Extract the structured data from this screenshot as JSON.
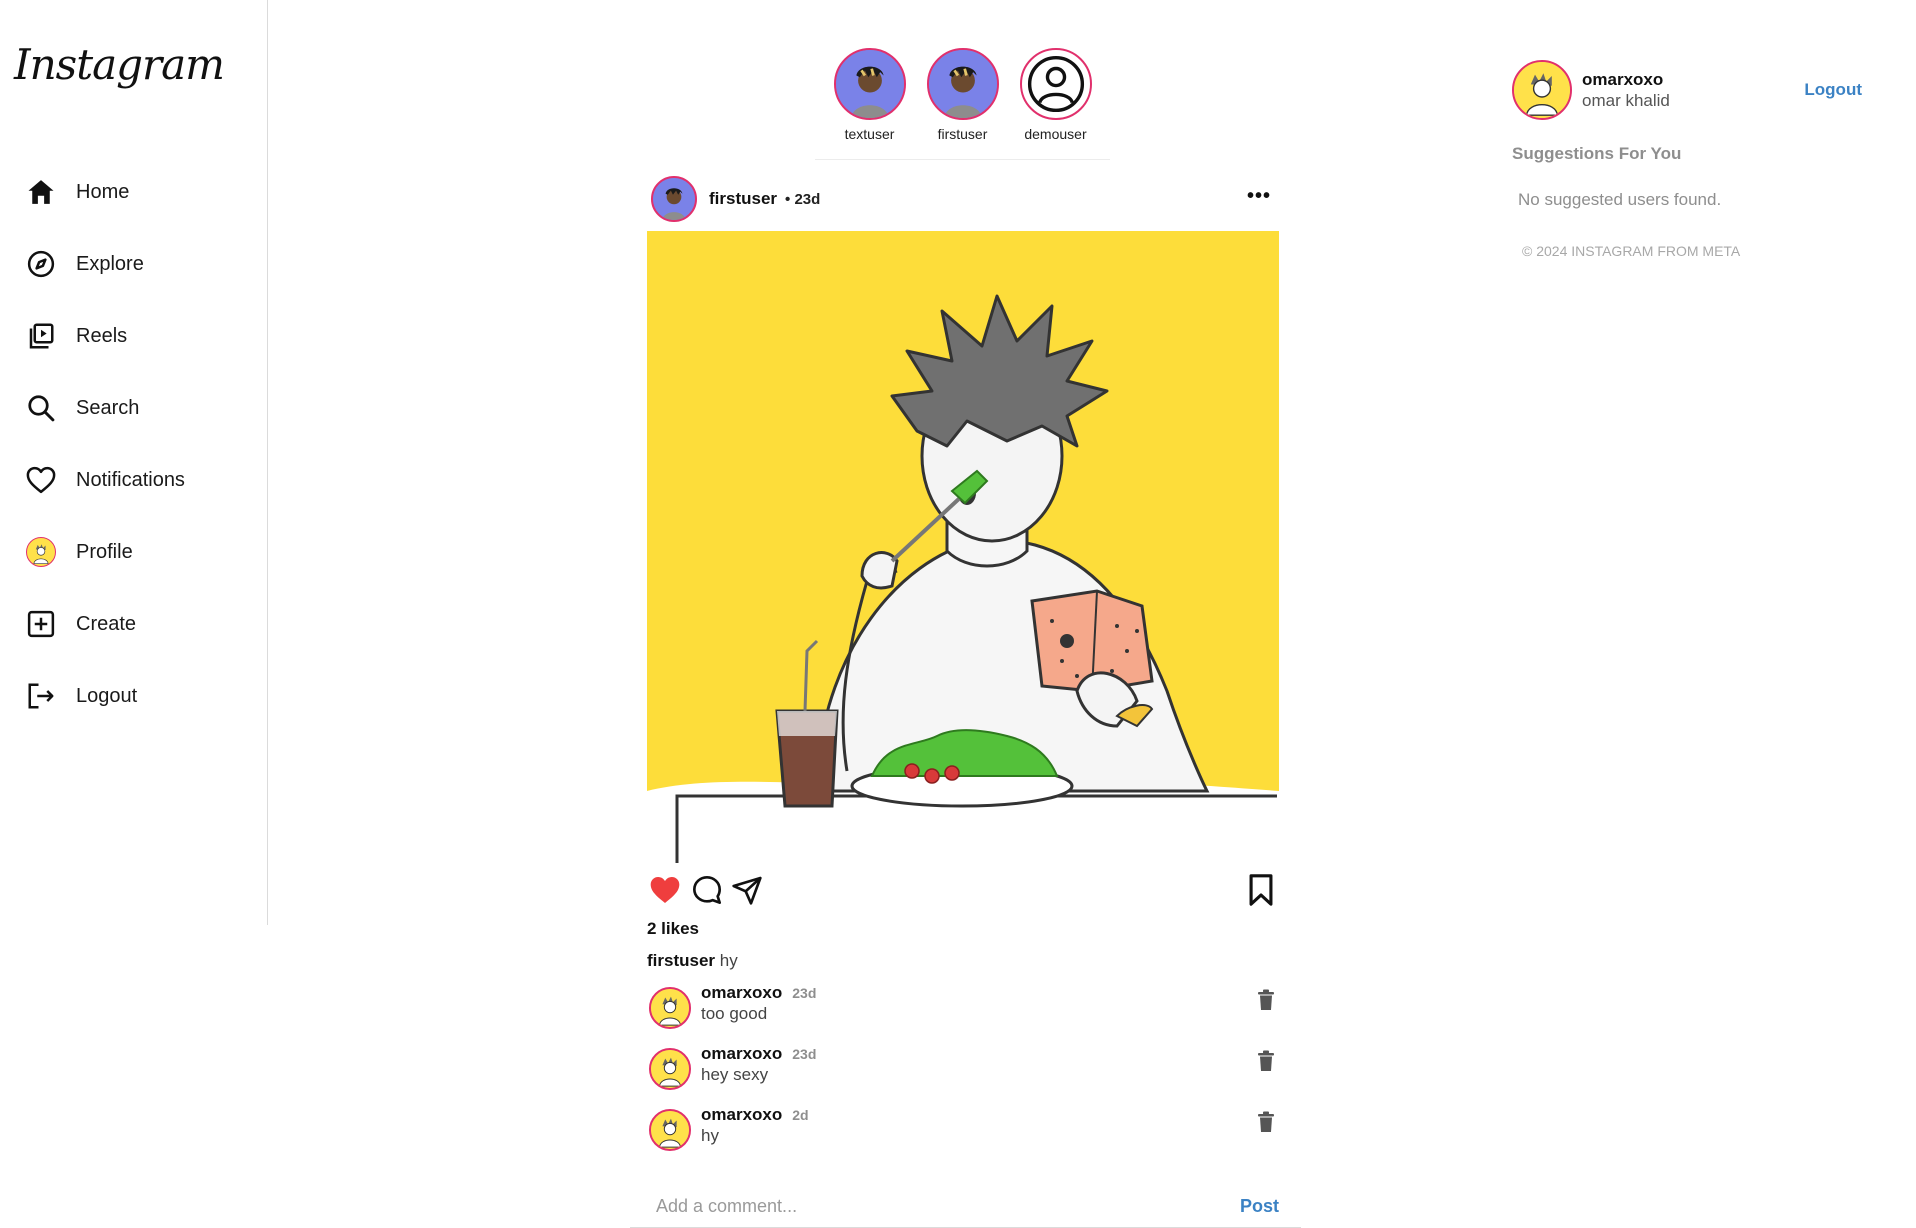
{
  "app": {
    "logo": "Instagram"
  },
  "sidebar": {
    "items": [
      {
        "label": "Home",
        "icon": "home-icon"
      },
      {
        "label": "Explore",
        "icon": "compass-icon"
      },
      {
        "label": "Reels",
        "icon": "reels-icon"
      },
      {
        "label": "Search",
        "icon": "search-icon"
      },
      {
        "label": "Notifications",
        "icon": "heart-icon"
      },
      {
        "label": "Profile",
        "icon": "profile-avatar"
      },
      {
        "label": "Create",
        "icon": "plus-square-icon"
      },
      {
        "label": "Logout",
        "icon": "logout-icon"
      }
    ]
  },
  "stories": [
    {
      "username": "textuser"
    },
    {
      "username": "firstuser"
    },
    {
      "username": "demouser"
    }
  ],
  "post": {
    "username": "firstuser",
    "time": "• 23d",
    "likes": "2 likes",
    "liked": true,
    "caption_user": "firstuser",
    "caption_text": "hy",
    "comments": [
      {
        "username": "omarxoxo",
        "time": "23d",
        "text": "too good"
      },
      {
        "username": "omarxoxo",
        "time": "23d",
        "text": "hey sexy"
      },
      {
        "username": "omarxoxo",
        "time": "2d",
        "text": "hy"
      }
    ],
    "comment_placeholder": "Add a comment...",
    "post_button": "Post"
  },
  "right": {
    "username": "omarxoxo",
    "fullname": "omar khalid",
    "logout": "Logout",
    "suggestions_title": "Suggestions For You",
    "suggestions_empty": "No suggested users found.",
    "footer": "© 2024 INSTAGRAM FROM META"
  },
  "colors": {
    "accent": "#3b82c4",
    "like_red": "#ef3e3e",
    "story_ring": "#e1306c",
    "post_bg_yellow": "#fddd3a"
  }
}
